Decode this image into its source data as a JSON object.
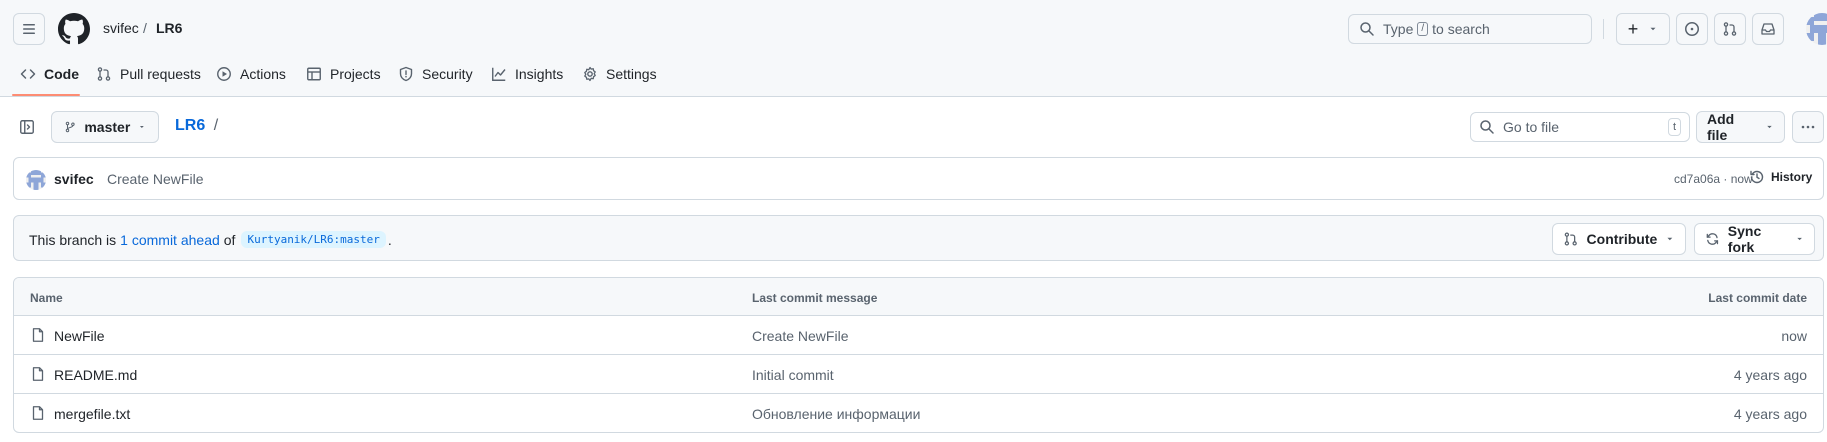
{
  "header": {
    "owner": "svifec",
    "separator": "/",
    "repo": "LR6",
    "search": {
      "prefix": "Type",
      "key": "/",
      "suffix": "to search"
    },
    "plus_label": "+"
  },
  "tabs": [
    {
      "label": "Code",
      "icon": "code-icon",
      "active": true
    },
    {
      "label": "Pull requests",
      "icon": "git-pull-request-icon"
    },
    {
      "label": "Actions",
      "icon": "play-icon"
    },
    {
      "label": "Projects",
      "icon": "table-icon"
    },
    {
      "label": "Security",
      "icon": "shield-icon"
    },
    {
      "label": "Insights",
      "icon": "graph-icon"
    },
    {
      "label": "Settings",
      "icon": "gear-icon"
    }
  ],
  "toolbar": {
    "branch": "master",
    "breadcrumb_repo": "LR6",
    "breadcrumb_sep": "/",
    "go_to_file_placeholder": "Go to file",
    "go_to_file_key": "t",
    "add_file_label": "Add file"
  },
  "latest_commit": {
    "author": "svifec",
    "message": "Create NewFile",
    "hash_time": "cd7a06a · now",
    "history_label": "History"
  },
  "ahead_banner": {
    "prefix": "This branch is",
    "link": "1 commit ahead",
    "of": "of",
    "ref": "Kurtyanik/LR6:master",
    "suffix": ".",
    "contribute_label": "Contribute",
    "sync_fork_label": "Sync fork"
  },
  "file_table": {
    "columns": [
      "Name",
      "Last commit message",
      "Last commit date"
    ],
    "rows": [
      {
        "name": "NewFile",
        "message": "Create NewFile",
        "date": "now"
      },
      {
        "name": "README.md",
        "message": "Initial commit",
        "date": "4 years ago"
      },
      {
        "name": "mergefile.txt",
        "message": "Обновление информации",
        "date": "4 years ago"
      }
    ]
  },
  "colors": {
    "link": "#0969da",
    "active_tab_underline": "#fd8c73",
    "muted_text": "#59636e",
    "border": "#d1d9e0"
  }
}
